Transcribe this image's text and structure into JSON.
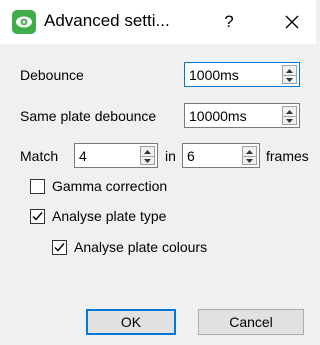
{
  "window": {
    "title": "Advanced setti...",
    "help_label": "?",
    "icon": "eye-icon",
    "close_icon": "close-icon",
    "accent_color": "#0078d7",
    "icon_color": "#3fae4a"
  },
  "form": {
    "debounce": {
      "label": "Debounce",
      "value": "1000ms"
    },
    "same_plate_debounce": {
      "label": "Same plate debounce",
      "value": "10000ms"
    },
    "match": {
      "label": "Match",
      "count_value": "4",
      "in_label": "in",
      "frames_value": "6",
      "frames_label": "frames"
    },
    "gamma_correction": {
      "label": "Gamma correction",
      "checked": false
    },
    "analyse_plate_type": {
      "label": "Analyse plate type",
      "checked": true
    },
    "analyse_plate_colours": {
      "label": "Analyse plate colours",
      "checked": true
    }
  },
  "buttons": {
    "ok": "OK",
    "cancel": "Cancel"
  }
}
